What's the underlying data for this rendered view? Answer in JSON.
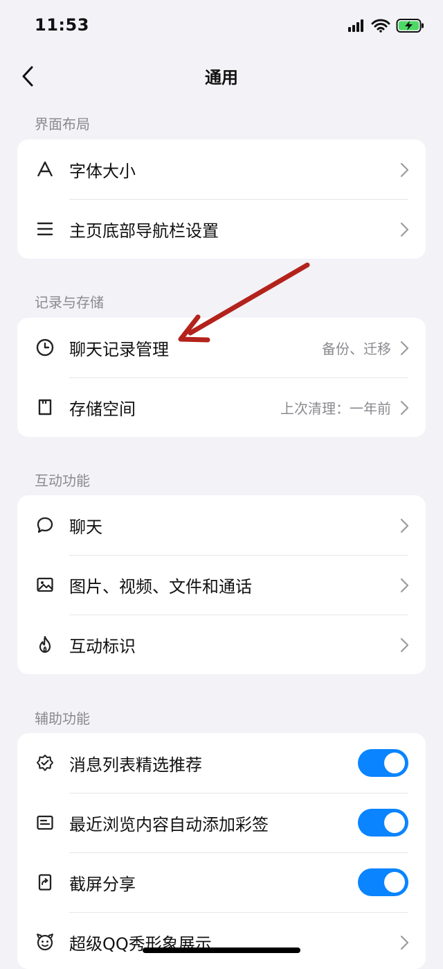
{
  "status_bar": {
    "time": "11:53"
  },
  "nav": {
    "title": "通用"
  },
  "sections": {
    "layout": {
      "label": "界面布局",
      "items": [
        {
          "label": "字体大小",
          "icon": "font-size-icon"
        },
        {
          "label": "主页底部导航栏设置",
          "icon": "menu-lines-icon"
        }
      ]
    },
    "storage": {
      "label": "记录与存储",
      "items": [
        {
          "label": "聊天记录管理",
          "value": "备份、迁移",
          "icon": "clock-icon"
        },
        {
          "label": "存储空间",
          "value": "上次清理：一年前",
          "icon": "storage-icon"
        }
      ]
    },
    "interaction": {
      "label": "互动功能",
      "items": [
        {
          "label": "聊天",
          "icon": "chat-bubble-icon"
        },
        {
          "label": "图片、视频、文件和通话",
          "icon": "image-icon"
        },
        {
          "label": "互动标识",
          "icon": "flame-icon"
        }
      ]
    },
    "accessibility": {
      "label": "辅助功能",
      "items": [
        {
          "label": "消息列表精选推荐",
          "toggle": true,
          "icon": "badge-check-icon"
        },
        {
          "label": "最近浏览内容自动添加彩签",
          "toggle": true,
          "icon": "note-card-icon"
        },
        {
          "label": "截屏分享",
          "toggle": true,
          "icon": "screenshot-share-icon"
        },
        {
          "label": "超级QQ秀形象展示",
          "icon": "penguin-face-icon"
        }
      ]
    }
  },
  "colors": {
    "accent": "#0a84ff",
    "annotation_arrow": "#b3231c",
    "background": "#f2f2f7"
  }
}
